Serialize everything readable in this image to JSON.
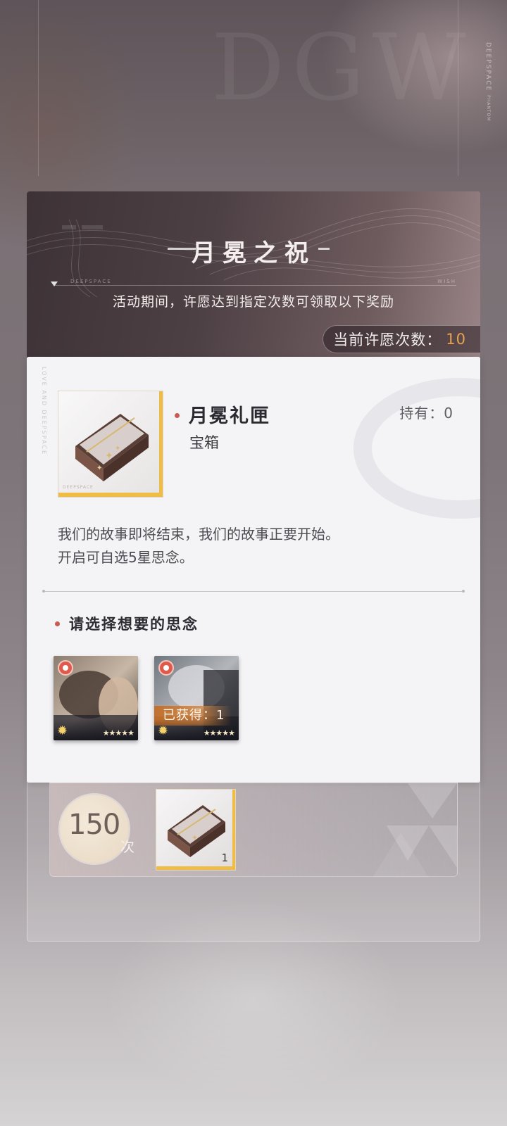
{
  "background": {
    "watermark": "DGW",
    "vertical_brand": "DEEPSPACE",
    "vertical_sub": "PHANTOM"
  },
  "banner": {
    "title": "月冕之祝",
    "tag_left": "DEEPSPACE",
    "tag_right": "WISH",
    "subtitle": "活动期间，许愿达到指定次数可领取以下奖励",
    "wish_count_label": "当前许愿次数：",
    "wish_count_value": "10"
  },
  "item": {
    "name": "月冕礼匣",
    "type": "宝箱",
    "owned_label": "持有：0",
    "vertical_tag": "LOVE AND DEEPSPACE",
    "thumb_tag": "DEEPSPACE",
    "description_line1": "我们的故事即将结束，我们的故事正要开始。",
    "description_line2": "开启可自选5星思念。",
    "choose_title": "请选择想要的思念",
    "memories": [
      {
        "stars": "★★★★★",
        "obtained": ""
      },
      {
        "stars": "★★★★★",
        "obtained": "已获得：1"
      }
    ]
  },
  "reward": {
    "count": "150",
    "unit": "次",
    "quantity": "1"
  },
  "colors": {
    "accent_gold": "#efbc46",
    "count_orange": "#e8a24f",
    "dot_red": "#c95b55",
    "obtained_orange": "#c36e28"
  }
}
